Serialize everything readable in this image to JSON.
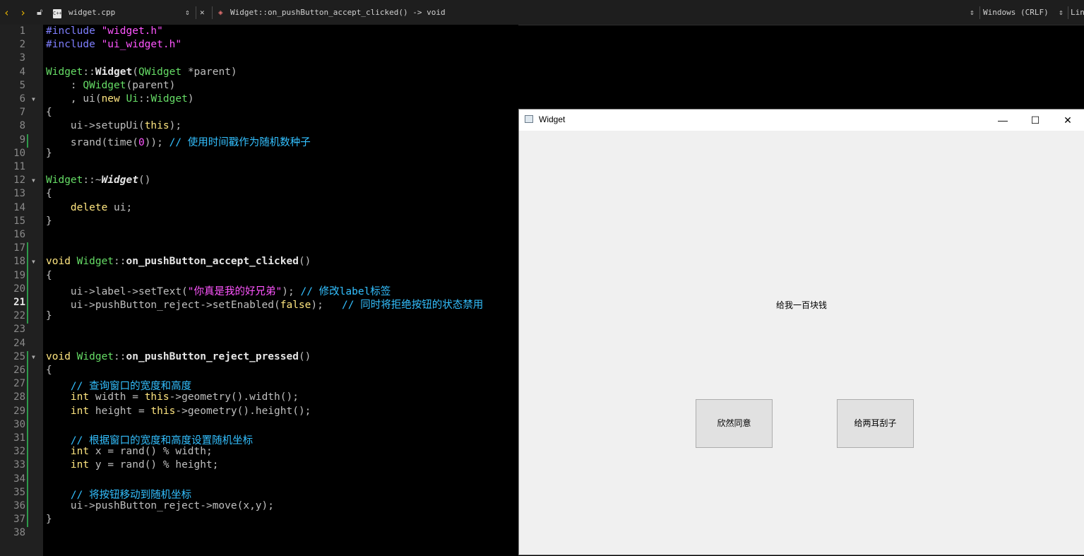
{
  "toolbar": {
    "file_name": "widget.cpp",
    "function": "Widget::on_pushButton_accept_clicked() -> void",
    "encoding": "Windows (CRLF)",
    "line_col": "Lin",
    "file_icon_text": "C++"
  },
  "editor": {
    "current_line": 21,
    "lines": [
      {
        "n": "1",
        "html": "<span class=\"k-pre\">#include</span> <span class=\"k-str\">\"widget.h\"</span>"
      },
      {
        "n": "2",
        "html": "<span class=\"k-pre\">#include</span> <span class=\"k-str\">\"ui_widget.h\"</span>"
      },
      {
        "n": "3",
        "html": ""
      },
      {
        "n": "4",
        "html": "<span class=\"k-cls\">Widget</span>::<span class=\"k-fn\">Widget</span>(<span class=\"k-cls\">QWidget</span> *parent)"
      },
      {
        "n": "5",
        "html": "    : <span class=\"k-cls\">QWidget</span>(parent)"
      },
      {
        "n": "6",
        "html": "    , ui(<span class=\"k-kw\">new</span> <span class=\"k-cls\">Ui</span>::<span class=\"k-cls\">Widget</span>)"
      },
      {
        "n": "7",
        "html": "{"
      },
      {
        "n": "8",
        "html": "    ui->setupUi(<span class=\"k-kw\">this</span>);"
      },
      {
        "n": "9",
        "html": "    srand(time(<span class=\"k-num\">0</span>)); <span class=\"k-cm\">// 使用时间戳作为随机数种子</span>"
      },
      {
        "n": "10",
        "html": "}"
      },
      {
        "n": "11",
        "html": ""
      },
      {
        "n": "12",
        "html": "<span class=\"k-cls\">Widget</span>::~<span class=\"k-it\">Widget</span>()"
      },
      {
        "n": "13",
        "html": "{"
      },
      {
        "n": "14",
        "html": "    <span class=\"k-kw\">delete</span> ui;"
      },
      {
        "n": "15",
        "html": "}"
      },
      {
        "n": "16",
        "html": ""
      },
      {
        "n": "17",
        "html": ""
      },
      {
        "n": "18",
        "html": "<span class=\"k-kw\">void</span> <span class=\"k-cls\">Widget</span>::<span class=\"k-fn\">on_pushButton_accept_clicked</span>()"
      },
      {
        "n": "19",
        "html": "{"
      },
      {
        "n": "20",
        "html": "    ui->label->setText(<span class=\"k-str\">\"你真是我的好兄弟\"</span>); <span class=\"k-cm\">// 修改label标签</span>"
      },
      {
        "n": "21",
        "html": "    ui->pushButton_reject->setEnabled(<span class=\"k-kw\">false</span>);   <span class=\"k-cm\">// 同时将拒绝按钮的状态禁用</span>"
      },
      {
        "n": "22",
        "html": "}"
      },
      {
        "n": "23",
        "html": ""
      },
      {
        "n": "24",
        "html": ""
      },
      {
        "n": "25",
        "html": "<span class=\"k-kw\">void</span> <span class=\"k-cls\">Widget</span>::<span class=\"k-fn\">on_pushButton_reject_pressed</span>()"
      },
      {
        "n": "26",
        "html": "{"
      },
      {
        "n": "27",
        "html": "    <span class=\"k-cm\">// 查询窗口的宽度和高度</span>"
      },
      {
        "n": "28",
        "html": "    <span class=\"k-kw\">int</span> width = <span class=\"k-kw\">this</span>->geometry().width();"
      },
      {
        "n": "29",
        "html": "    <span class=\"k-kw\">int</span> height = <span class=\"k-kw\">this</span>->geometry().height();"
      },
      {
        "n": "30",
        "html": ""
      },
      {
        "n": "31",
        "html": "    <span class=\"k-cm\">// 根据窗口的宽度和高度设置随机坐标</span>"
      },
      {
        "n": "32",
        "html": "    <span class=\"k-kw\">int</span> x = rand() % width;"
      },
      {
        "n": "33",
        "html": "    <span class=\"k-kw\">int</span> y = rand() % height;"
      },
      {
        "n": "34",
        "html": ""
      },
      {
        "n": "35",
        "html": "    <span class=\"k-cm\">// 将按钮移动到随机坐标</span>"
      },
      {
        "n": "36",
        "html": "    ui->pushButton_reject->move(x,y);"
      },
      {
        "n": "37",
        "html": "}"
      },
      {
        "n": "38",
        "html": ""
      }
    ],
    "folds": [
      6,
      12,
      18,
      25
    ],
    "changed_lines": [
      9,
      17,
      18,
      19,
      20,
      21,
      22,
      25,
      26,
      27,
      28,
      29,
      30,
      31,
      32,
      33,
      34,
      35,
      36,
      37
    ]
  },
  "app_window": {
    "title": "Widget",
    "minimize": "—",
    "maximize": "☐",
    "close": "✕",
    "label_text": "给我一百块钱",
    "accept_button": "欣然同意",
    "reject_button": "给两耳刮子"
  }
}
